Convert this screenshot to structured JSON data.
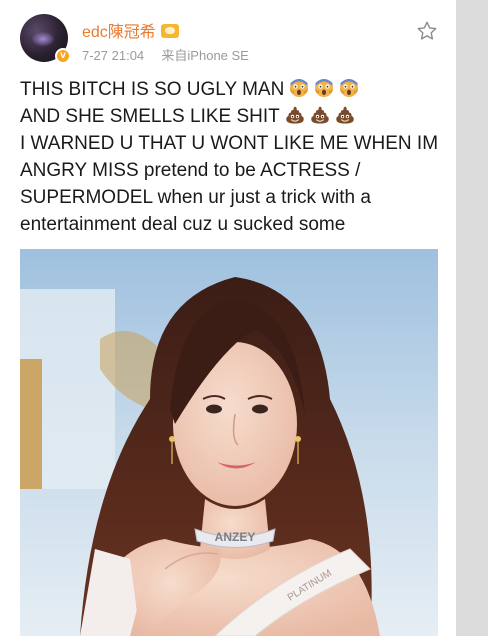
{
  "post": {
    "author": {
      "username": "edc陳冠希",
      "avatar_icon": "avatar-image",
      "verified_badge_icon": "verified-v-icon",
      "vip_icon": "vip-crown-icon"
    },
    "timestamp": "7-27 21:04",
    "source": "来自iPhone SE",
    "favorite_icon": "star-outline-icon",
    "text_lines": [
      "THIS BITCH IS SO UGLY MAN",
      "AND SHE SMELLS LIKE SHIT",
      "I WARNED U THAT U WONT LIKE ME WHEN IM",
      "ANGRY MISS pretend to be ACTRESS /",
      "SUPERMODEL when ur just a trick with a",
      "entertainment deal cuz u sucked some"
    ],
    "line1_emoji": [
      "screaming-face-emoji",
      "screaming-face-emoji",
      "screaming-face-emoji"
    ],
    "line2_emoji": [
      "pile-of-poo-emoji",
      "pile-of-poo-emoji",
      "pile-of-poo-emoji"
    ],
    "photo": {
      "necklace_text": "ANZEY",
      "sash_text": "PLATINUM"
    }
  },
  "colors": {
    "username": "#eb7a2e",
    "meta_text": "#9a9a9a",
    "body_text": "#1a1a1a",
    "vip_gold": "#f5b732"
  }
}
